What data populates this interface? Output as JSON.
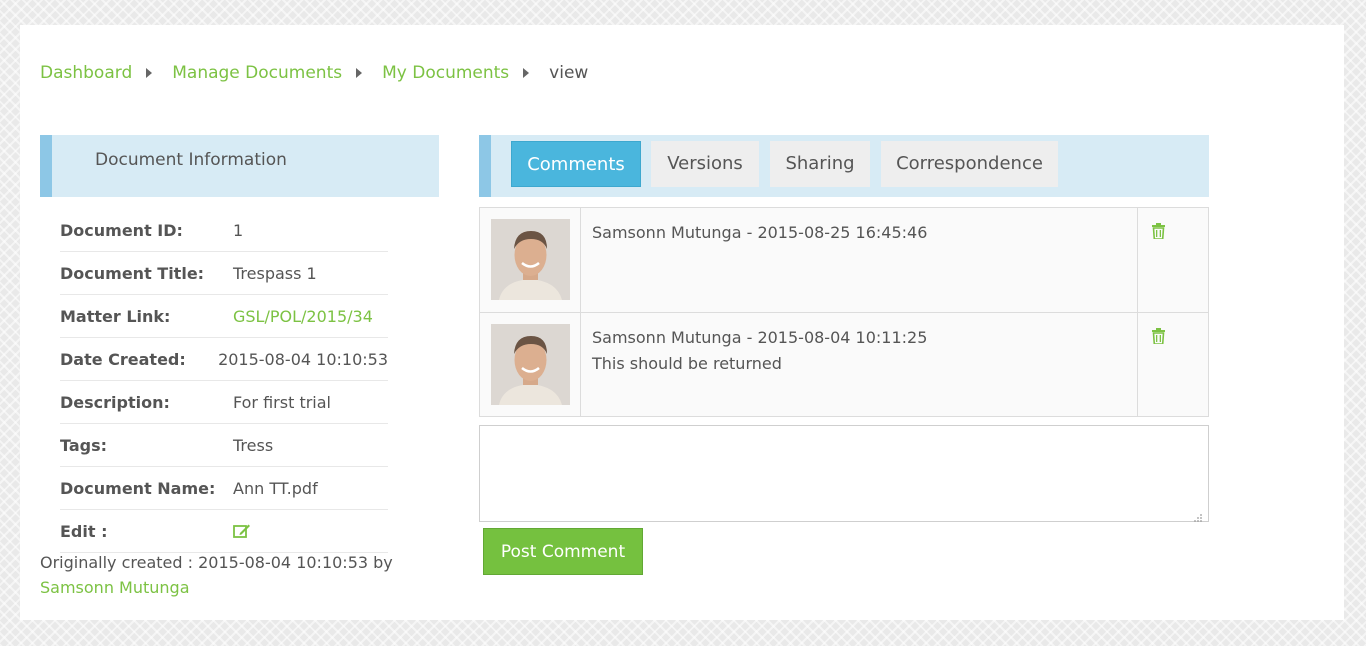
{
  "breadcrumb": {
    "items": [
      "Dashboard",
      "Manage Documents",
      "My Documents"
    ],
    "current": "view"
  },
  "document_info": {
    "heading": "Document Information",
    "rows": [
      {
        "label": "Document ID:",
        "value": "1"
      },
      {
        "label": "Document Title:",
        "value": "Trespass 1"
      },
      {
        "label": "Matter Link:",
        "value": "GSL/POL/2015/34"
      },
      {
        "label": "Date Created:",
        "value": "2015-08-04 10:10:53"
      },
      {
        "label": "Description:",
        "value": "For first trial"
      },
      {
        "label": "Tags:",
        "value": "Tress"
      },
      {
        "label": "Document Name:",
        "value": "Ann TT.pdf"
      },
      {
        "label": "Edit :",
        "icon": "edit-icon"
      }
    ],
    "originally_created_prefix": "Originally created : 2015-08-04 10:10:53 by",
    "originally_created_by": "Samsonn Mutunga"
  },
  "tabs": [
    {
      "label": "Comments",
      "active": true
    },
    {
      "label": "Versions",
      "active": false
    },
    {
      "label": "Sharing",
      "active": false
    },
    {
      "label": "Correspondence",
      "active": false
    }
  ],
  "comments": [
    {
      "header": "Samsonn Mutunga - 2015-08-25 16:45:46",
      "text": ""
    },
    {
      "header": "Samsonn Mutunga - 2015-08-04 10:11:25",
      "text": "This should be returned"
    }
  ],
  "comment_input": {
    "value": "",
    "placeholder": ""
  },
  "post_button_label": "Post Comment",
  "icons": {
    "delete": "trash-icon",
    "edit": "edit-icon",
    "breadcrumb_separator": "caret-right-icon"
  },
  "colors": {
    "accent_green": "#7cc243",
    "tab_active_blue": "#4ab6dd",
    "header_bg": "#d7ebf5"
  }
}
